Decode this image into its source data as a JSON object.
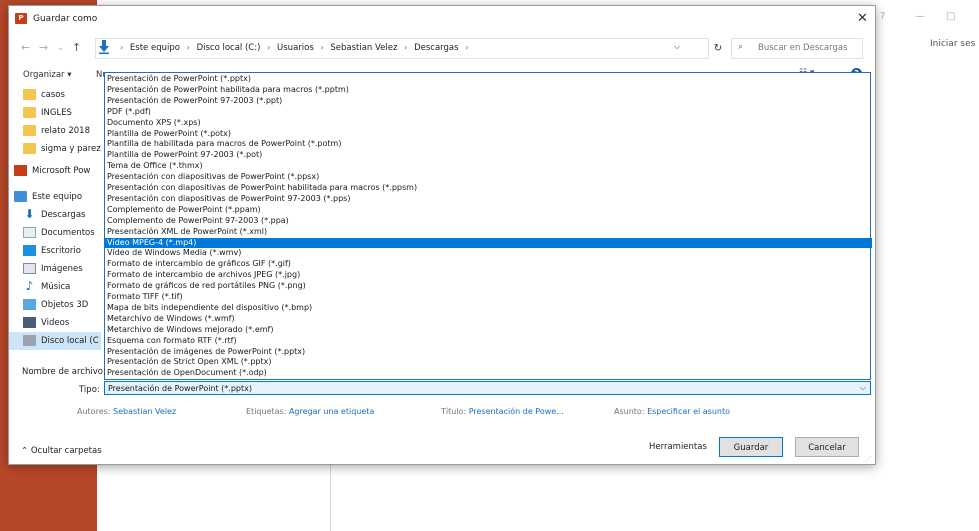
{
  "background": {
    "signin": "Iniciar ses"
  },
  "dialog": {
    "title": "Guardar como",
    "close": "✕",
    "breadcrumb": [
      "Este equipo",
      "Disco local (C:)",
      "Usuarios",
      "Sebastian Velez",
      "Descargas"
    ],
    "search_placeholder": "Buscar en Descargas",
    "organize": "Organizar ▾",
    "new_folder": "Nu",
    "nav_items": [
      {
        "label": "casos",
        "icon": "folder-icon"
      },
      {
        "label": "INGLES",
        "icon": "folder-icon"
      },
      {
        "label": "relato 2018",
        "icon": "folder-icon"
      },
      {
        "label": "sigma y parez",
        "icon": "folder-icon"
      },
      {
        "label": "Microsoft Pow",
        "icon": "powerpoint-icon"
      },
      {
        "label": "Este equipo",
        "icon": "computer-icon"
      },
      {
        "label": "Descargas",
        "icon": "download-icon"
      },
      {
        "label": "Documentos",
        "icon": "document-icon"
      },
      {
        "label": "Escritorio",
        "icon": "desktop-icon"
      },
      {
        "label": "Imágenes",
        "icon": "image-icon"
      },
      {
        "label": "Música",
        "icon": "music-icon"
      },
      {
        "label": "Objetos 3D",
        "icon": "objects3d-icon"
      },
      {
        "label": "Videos",
        "icon": "video-icon"
      },
      {
        "label": "Disco local (C",
        "icon": "disk-icon"
      }
    ],
    "file_types": [
      "Presentación de PowerPoint (*.pptx)",
      "Presentación de PowerPoint habilitada para macros (*.pptm)",
      "Presentación de PowerPoint 97-2003 (*.ppt)",
      "PDF (*.pdf)",
      "Documento XPS (*.xps)",
      "Plantilla de PowerPoint (*.potx)",
      "Plantilla de habilitada para macros de PowerPoint (*.potm)",
      "Plantilla de PowerPoint 97-2003 (*.pot)",
      "Tema de Office (*.thmx)",
      "Presentación con diapositivas de PowerPoint (*.ppsx)",
      "Presentación con diapositivas de PowerPoint habilitada para macros (*.ppsm)",
      "Presentación con diapositivas de PowerPoint 97-2003 (*.pps)",
      "Complemento de PowerPoint (*.ppam)",
      "Complemento de PowerPoint 97-2003 (*.ppa)",
      "Presentación XML de PowerPoint (*.xml)",
      "Vídeo MPEG-4 (*.mp4)",
      "Vídeo de Windows Media (*.wmv)",
      "Formato de intercambio de gráficos GIF (*.gif)",
      "Formato de intercambio de archivos JPEG (*.jpg)",
      "Formato de gráficos de red portátiles PNG (*.png)",
      "Formato TIFF (*.tif)",
      "Mapa de bits independiente del dispositivo (*.bmp)",
      "Metarchivo de Windows (*.wmf)",
      "Metarchivo de Windows mejorado (*.emf)",
      "Esquema con formato RTF (*.rtf)",
      "Presentación de imágenes de PowerPoint (*.pptx)",
      "Presentación de Strict Open XML (*.pptx)",
      "Presentación de OpenDocument (*.odp)"
    ],
    "selected_type_index": 15,
    "filename_label": "Nombre de archivo:",
    "type_label": "Tipo:",
    "type_value": "Presentación de PowerPoint (*.pptx)",
    "meta": {
      "authors_label": "Autores:",
      "authors_value": "Sebastian Velez",
      "tags_label": "Etiquetas:",
      "tags_value": "Agregar una etiqueta",
      "title_label": "Título:",
      "title_value": "Presentación de Powe...",
      "subject_label": "Asunto:",
      "subject_value": "Especificar el asunto"
    },
    "hide_folders": "Ocultar carpetas",
    "tools": "Herramientas",
    "save": "Guardar",
    "cancel": "Cancelar"
  }
}
